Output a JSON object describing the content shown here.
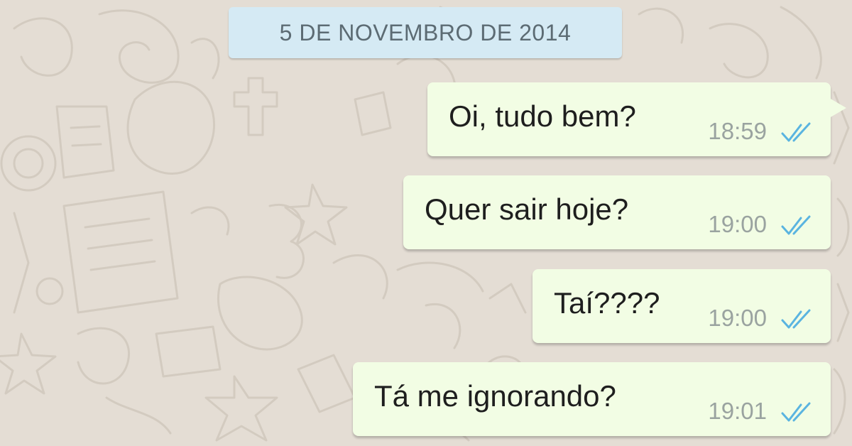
{
  "chat": {
    "date_label": "5 DE NOVEMBRO DE 2014",
    "messages": [
      {
        "text": "Oi, tudo bem?",
        "time": "18:59",
        "status_icon": "double-check-icon"
      },
      {
        "text": "Quer sair hoje?",
        "time": "19:00",
        "status_icon": "double-check-icon"
      },
      {
        "text": "Taí????",
        "time": "19:00",
        "status_icon": "double-check-icon"
      },
      {
        "text": "Tá me ignorando?",
        "time": "19:01",
        "status_icon": "double-check-icon"
      }
    ]
  },
  "colors": {
    "background": "#e4ddd4",
    "date_pill": "#d5eaf4",
    "outgoing_bubble": "#f2fde4",
    "check_marks": "#5ab4e0"
  }
}
